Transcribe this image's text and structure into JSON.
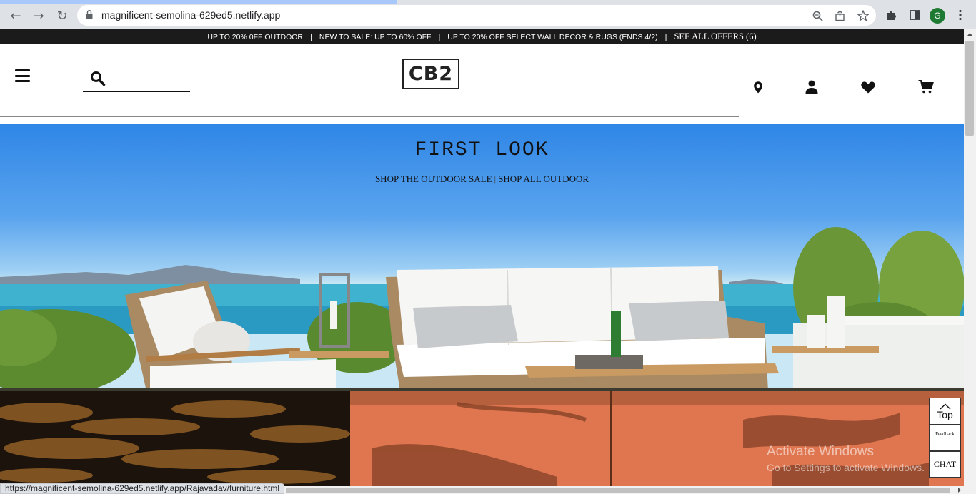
{
  "browser": {
    "url": "magnificent-semolina-629ed5.netlify.app",
    "avatar_letter": "G",
    "status_url": "https://magnificent-semolina-629ed5.netlify.app/Rajavadav/furniture.html"
  },
  "promo": {
    "items": [
      "UP TO 20% 0FF OUTDOOR",
      "NEW TO SALE: UP TO 60% OFF",
      "UP TO 20% OFF SELECT WALL DECOR & RUGS (ENDS 4/2)"
    ],
    "see_all": "SEE ALL OFFERS (6)",
    "separator": "|"
  },
  "header": {
    "logo": "CB2",
    "icons": [
      "menu-icon",
      "search-icon",
      "location-pin-icon",
      "account-icon",
      "wishlist-heart-icon",
      "cart-icon"
    ]
  },
  "hero": {
    "title": "FIRST LOOK",
    "link_outdoor_sale": "SHOP THE OUTDOOR SALE",
    "link_separator": "|",
    "link_all_outdoor": "SHOP ALL OUTDOOR"
  },
  "floating": {
    "top_label": "Top",
    "feedback_label": "Feedback",
    "chat_label": "CHAT"
  },
  "watermark": {
    "title": "Activate Windows",
    "subtitle": "Go to Settings to activate Windows."
  }
}
